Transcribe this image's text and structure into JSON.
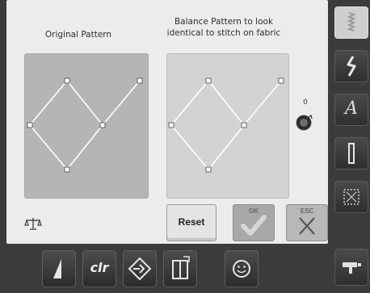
{
  "headings": {
    "original": "Original Pattern",
    "balance": "Balance Pattern to look identical to stitch on fabric"
  },
  "balance_control": {
    "value": "0",
    "knob_icon": "rotary-knob-icon"
  },
  "buttons": {
    "reset": "Reset",
    "ok": "OK",
    "esc": "ESC"
  },
  "bottom_bar": {
    "clr": "clr"
  },
  "sidebar_icons": [
    "utility-stitches-icon",
    "decorative-stitches-icon",
    "alphabets-icon",
    "buttonholes-icon",
    "quilt-stitches-icon",
    "setup-program-icon"
  ],
  "colors": {
    "background": "#3b3b3b",
    "content": "#ececec",
    "accent": "#ffffff"
  }
}
